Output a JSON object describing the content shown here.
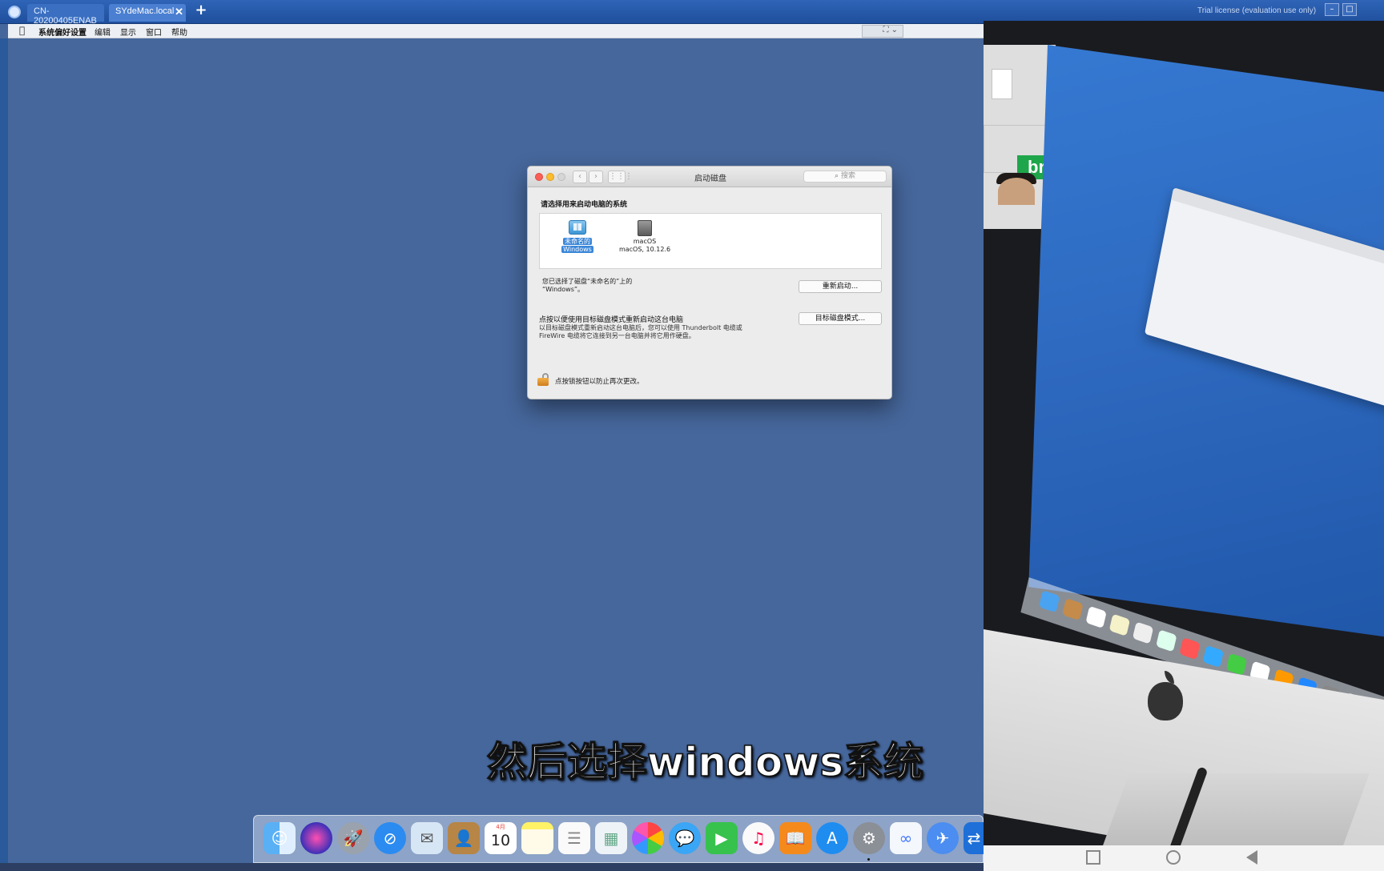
{
  "viewer": {
    "tabs": [
      {
        "label": "CN-20200405ENAB"
      },
      {
        "label": "SYdeMac.local"
      }
    ],
    "tab_close": "✕",
    "tab_add": "+",
    "license_text": "Trial license (evaluation use only)"
  },
  "menubar": {
    "apple": "",
    "items": [
      "系统偏好设置",
      "编辑",
      "显示",
      "窗口",
      "帮助"
    ]
  },
  "startup_disk": {
    "window_title": "启动磁盘",
    "search_placeholder": "搜索",
    "heading": "请选择用来启动电脑的系统",
    "disks": [
      {
        "name_line1": "未命名的",
        "name_line2": "Windows",
        "selected": true
      },
      {
        "name_line1": "macOS",
        "name_line2": "macOS, 10.12.6",
        "selected": false
      }
    ],
    "selected_text_line1": "您已选择了磁盘“未命名的”上的",
    "selected_text_line2": "“Windows”。",
    "restart_button": "重新启动...",
    "target_mode_title": "点按以便使用目标磁盘模式重新启动这台电脑",
    "target_mode_desc_line1": "以目标磁盘模式重新启动这台电脑后，您可以使用 Thunderbolt 电缆或",
    "target_mode_desc_line2": "FireWire 电缆将它连接到另一台电脑并将它用作硬盘。",
    "target_mode_button": "目标磁盘模式...",
    "lock_text": "点按锁按钮以防止再次更改。"
  },
  "caption": "然后选择windows系统",
  "dock": {
    "calendar_month": "4月",
    "calendar_day": "10"
  },
  "colors": {
    "desktop_blue": "#46679c",
    "caption_text": "#ffffff",
    "selection_blue": "#3a86d8"
  }
}
